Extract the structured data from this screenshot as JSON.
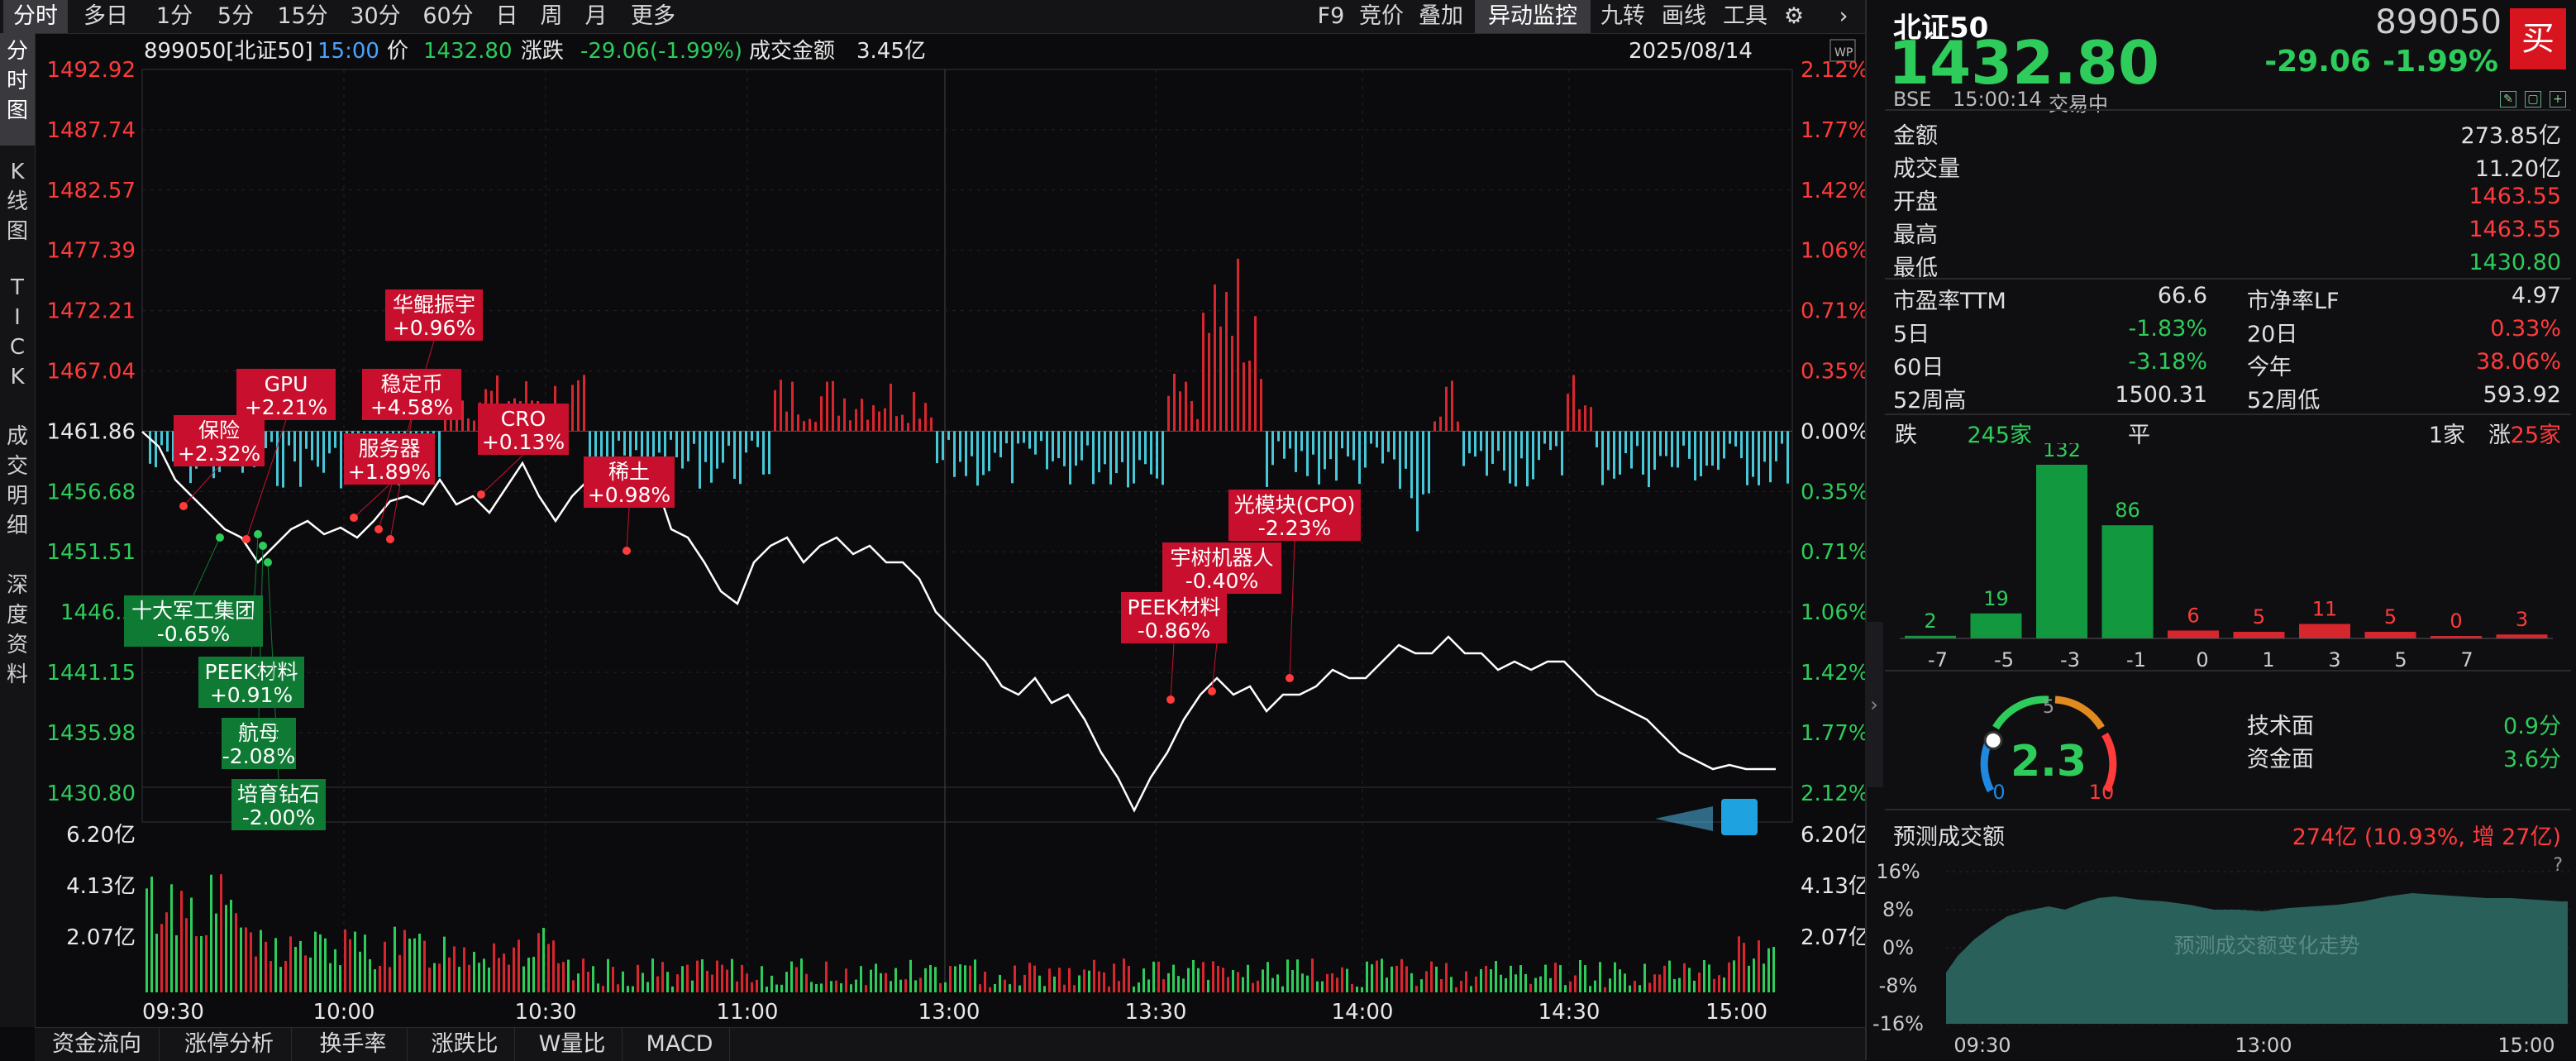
{
  "toolbar": {
    "tabs": [
      "分时",
      "多日",
      "1分",
      "5分",
      "15分",
      "30分",
      "60分",
      "日",
      "周",
      "月",
      "更多"
    ],
    "right_tabs": [
      "F9",
      "竞价",
      "叠加",
      "异动监控",
      "九转",
      "画线",
      "工具"
    ]
  },
  "left_tabs": [
    "分\n时\n图",
    "K\n线\n图",
    "T\nI\nC\nK",
    "成\n交\n明\n细",
    "深\n度\n资\n料"
  ],
  "info_bar": {
    "code_name": "899050[北证50]",
    "time": "15:00",
    "price_label": "价",
    "price": "1432.80",
    "change_label": "涨跌",
    "change": "-29.06(-1.99%)",
    "amount_label": "成交金额",
    "amount": "3.45亿",
    "date": "2025/08/14",
    "corner_badge": "WP"
  },
  "y_axis_left": [
    "1492.92",
    "1487.74",
    "1482.57",
    "1477.39",
    "1472.21",
    "1467.04",
    "1461.86",
    "1456.68",
    "1451.51",
    "1446.3",
    "1441.15",
    "1435.98",
    "1430.80"
  ],
  "y_axis_right": [
    "2.12%",
    "1.77%",
    "1.42%",
    "1.06%",
    "0.71%",
    "0.35%",
    "0.00%",
    "0.35%",
    "0.71%",
    "1.06%",
    "1.42%",
    "1.77%",
    "2.12%"
  ],
  "volume_axis": [
    "6.20亿",
    "4.13亿",
    "2.07亿"
  ],
  "x_axis": [
    "09:30",
    "10:00",
    "10:30",
    "11:00",
    "13:00",
    "13:30",
    "14:00",
    "14:30",
    "15:00"
  ],
  "tags_red": [
    {
      "name": "保险",
      "pct": "+2.32%"
    },
    {
      "name": "GPU",
      "pct": "+2.21%"
    },
    {
      "name": "华鲲振宇",
      "pct": "+0.96%"
    },
    {
      "name": "稳定币",
      "pct": "+4.58%"
    },
    {
      "name": "服务器",
      "pct": "+1.89%"
    },
    {
      "name": "CRO",
      "pct": "+0.13%"
    },
    {
      "name": "稀土",
      "pct": "+0.98%"
    },
    {
      "name": "光模块(CPO)",
      "pct": "-2.23%"
    },
    {
      "name": "宇树机器人",
      "pct": "-0.40%"
    },
    {
      "name": "PEEK材料",
      "pct": "-0.86%"
    }
  ],
  "tags_green": [
    {
      "name": "十大军工集团",
      "pct": "-0.65%"
    },
    {
      "name": "PEEK材料",
      "pct": "+0.91%"
    },
    {
      "name": "航母",
      "pct": "-2.08%"
    },
    {
      "name": "培育钻石",
      "pct": "-2.00%"
    }
  ],
  "bottom_tabs": [
    "资金流向",
    "涨停分析",
    "换手率",
    "涨跌比",
    "W量比",
    "MACD"
  ],
  "quote": {
    "name": "北证50",
    "code": "899050",
    "price": "1432.80",
    "change": "-29.06",
    "change_pct": "-1.99%",
    "buy_label": "买",
    "exchange": "BSE",
    "time": "15:00:14",
    "status": "交易中"
  },
  "stats": [
    {
      "label": "金额",
      "value": "273.85亿",
      "color": "#e0e0e0"
    },
    {
      "label": "成交量",
      "value": "11.20亿",
      "color": "#e0e0e0"
    },
    {
      "label": "开盘",
      "value": "1463.55",
      "color": "#ff3b3b"
    },
    {
      "label": "最高",
      "value": "1463.55",
      "color": "#ff3b3b"
    },
    {
      "label": "最低",
      "value": "1430.80",
      "color": "#2ecc5a"
    }
  ],
  "valuation": [
    {
      "l1": "市盈率TTM",
      "v1": "66.6",
      "c1": "#e0e0e0",
      "l2": "市净率LF",
      "v2": "4.97",
      "c2": "#e0e0e0"
    },
    {
      "l1": "5日",
      "v1": "-1.83%",
      "c1": "#2ecc5a",
      "l2": "20日",
      "v2": "0.33%",
      "c2": "#ff3b3b"
    },
    {
      "l1": "60日",
      "v1": "-3.18%",
      "c1": "#2ecc5a",
      "l2": "今年",
      "v2": "38.06%",
      "c2": "#ff3b3b"
    },
    {
      "l1": "52周高",
      "v1": "1500.31",
      "c1": "#e0e0e0",
      "l2": "52周低",
      "v2": "593.92",
      "c2": "#e0e0e0"
    }
  ],
  "breadth": {
    "down_label": "跌",
    "down": "245家",
    "flat_label": "平",
    "flat": "1家",
    "up_label": "涨",
    "up": "25家"
  },
  "distribution": {
    "labels": [
      "-7",
      "-5",
      "-3",
      "-1",
      "0",
      "1",
      "3",
      "5",
      "7"
    ],
    "counts": [
      2,
      19,
      132,
      86,
      6,
      5,
      11,
      5,
      0,
      3
    ]
  },
  "gauge": {
    "value": "2.3",
    "min": "0",
    "mid": "5",
    "max": "10",
    "level": 0.23,
    "tech_label": "技术面",
    "tech": "0.9分",
    "fund_label": "资金面",
    "fund": "3.6分"
  },
  "forecast": {
    "label": "预测成交额",
    "value": "274亿 (10.93%, 增 27亿)",
    "help": "?",
    "y_ticks": [
      "16%",
      "8%",
      "0%",
      "-8%",
      "-16%"
    ],
    "x_ticks": [
      "09:30",
      "13:00",
      "15:00"
    ],
    "watermark": "预测成交额变化走势"
  },
  "colors": {
    "up": "#ff3b3b",
    "down": "#2ecc5a",
    "line": "#ffffff",
    "cyan": "#46c8d8",
    "tag_red": "#c8102e",
    "tag_green": "#0f7a34"
  }
}
